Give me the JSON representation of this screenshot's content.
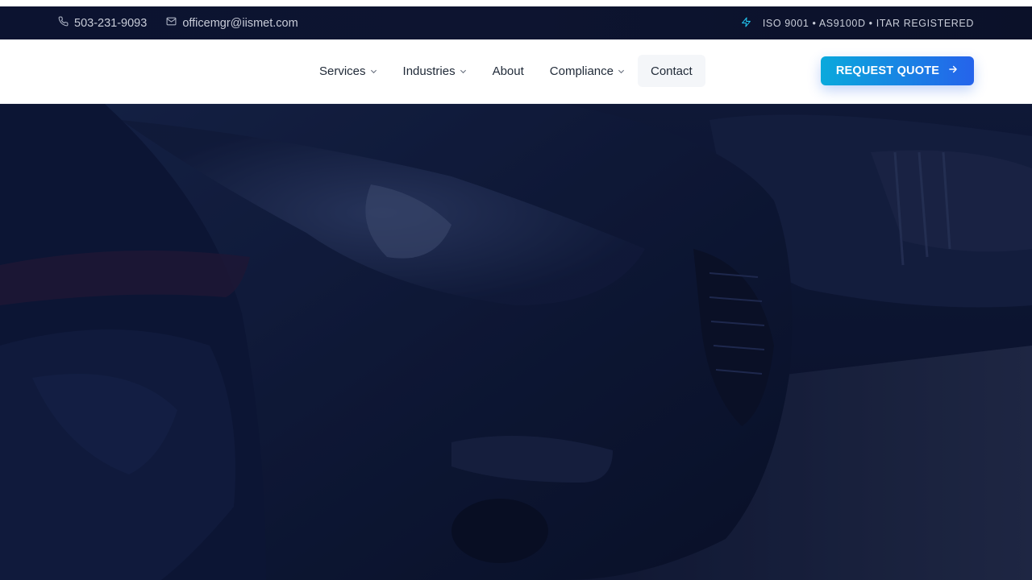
{
  "topbar": {
    "phone": "503-231-9093",
    "email": "officemgr@iismet.com",
    "certifications": "ISO 9001 • AS9100D • ITAR REGISTERED",
    "icons": {
      "phone": "phone-icon",
      "email": "mail-icon",
      "cert": "lightning-icon"
    }
  },
  "nav": {
    "items": [
      {
        "label": "Services",
        "has_dropdown": true
      },
      {
        "label": "Industries",
        "has_dropdown": true
      },
      {
        "label": "About",
        "has_dropdown": false
      },
      {
        "label": "Compliance",
        "has_dropdown": true
      },
      {
        "label": "Contact",
        "has_dropdown": false
      }
    ],
    "cta_label": "REQUEST QUOTE"
  },
  "hero": {
    "image": "row-of-parked-cars-photo"
  },
  "colors": {
    "topbar_bg": "#0c1330",
    "accent_start": "#0aa9dc",
    "accent_end": "#2563eb",
    "hero_overlay": "#0a1028"
  }
}
